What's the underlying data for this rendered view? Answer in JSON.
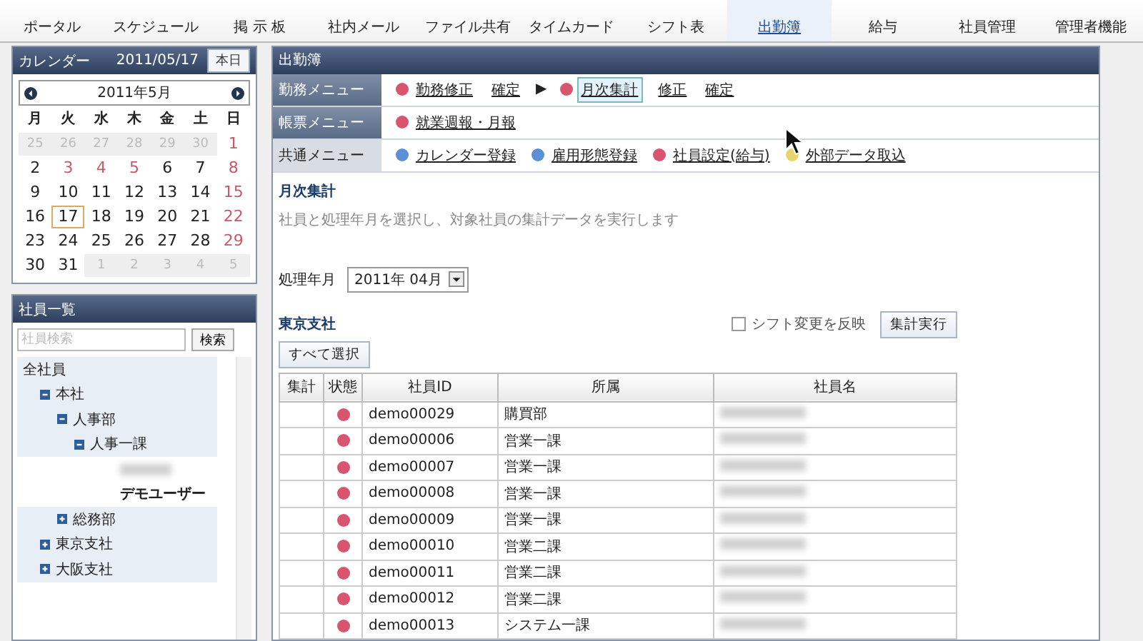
{
  "nav": [
    {
      "label": "ポータル",
      "selected": false
    },
    {
      "label": "スケジュール",
      "selected": false
    },
    {
      "label": "掲 示 板",
      "selected": false
    },
    {
      "label": "社内メール",
      "selected": false
    },
    {
      "label": "ファイル共有",
      "selected": false
    },
    {
      "label": "タイムカード",
      "selected": false
    },
    {
      "label": "シフト表",
      "selected": false
    },
    {
      "label": "出勤簿",
      "selected": true
    },
    {
      "label": "給与",
      "selected": false
    },
    {
      "label": "社員管理",
      "selected": false
    },
    {
      "label": "管理者機能",
      "selected": false
    }
  ],
  "calendar": {
    "title": "カレンダー",
    "date": "2011/05/17",
    "today_button": "本日",
    "month": "2011年5月",
    "weekdays": [
      "月",
      "火",
      "水",
      "木",
      "金",
      "土",
      "日"
    ],
    "weeks": [
      [
        {
          "label": "25",
          "muted": true,
          "holiday": false,
          "selected": false
        },
        {
          "label": "26",
          "muted": true,
          "holiday": false,
          "selected": false
        },
        {
          "label": "27",
          "muted": true,
          "holiday": false,
          "selected": false
        },
        {
          "label": "28",
          "muted": true,
          "holiday": false,
          "selected": false
        },
        {
          "label": "29",
          "muted": true,
          "holiday": false,
          "selected": false
        },
        {
          "label": "30",
          "muted": true,
          "holiday": false,
          "selected": false
        },
        {
          "label": "1",
          "muted": false,
          "holiday": true,
          "selected": false
        }
      ],
      [
        {
          "label": "2",
          "muted": false,
          "holiday": false,
          "selected": false
        },
        {
          "label": "3",
          "muted": false,
          "holiday": true,
          "selected": false
        },
        {
          "label": "4",
          "muted": false,
          "holiday": true,
          "selected": false
        },
        {
          "label": "5",
          "muted": false,
          "holiday": true,
          "selected": false
        },
        {
          "label": "6",
          "muted": false,
          "holiday": false,
          "selected": false
        },
        {
          "label": "7",
          "muted": false,
          "holiday": false,
          "selected": false
        },
        {
          "label": "8",
          "muted": false,
          "holiday": true,
          "selected": false
        }
      ],
      [
        {
          "label": "9",
          "muted": false,
          "holiday": false,
          "selected": false
        },
        {
          "label": "10",
          "muted": false,
          "holiday": false,
          "selected": false
        },
        {
          "label": "11",
          "muted": false,
          "holiday": false,
          "selected": false
        },
        {
          "label": "12",
          "muted": false,
          "holiday": false,
          "selected": false
        },
        {
          "label": "13",
          "muted": false,
          "holiday": false,
          "selected": false
        },
        {
          "label": "14",
          "muted": false,
          "holiday": false,
          "selected": false
        },
        {
          "label": "15",
          "muted": false,
          "holiday": true,
          "selected": false
        }
      ],
      [
        {
          "label": "16",
          "muted": false,
          "holiday": false,
          "selected": false
        },
        {
          "label": "17",
          "muted": false,
          "holiday": false,
          "selected": true
        },
        {
          "label": "18",
          "muted": false,
          "holiday": false,
          "selected": false
        },
        {
          "label": "19",
          "muted": false,
          "holiday": false,
          "selected": false
        },
        {
          "label": "20",
          "muted": false,
          "holiday": false,
          "selected": false
        },
        {
          "label": "21",
          "muted": false,
          "holiday": false,
          "selected": false
        },
        {
          "label": "22",
          "muted": false,
          "holiday": true,
          "selected": false
        }
      ],
      [
        {
          "label": "23",
          "muted": false,
          "holiday": false,
          "selected": false
        },
        {
          "label": "24",
          "muted": false,
          "holiday": false,
          "selected": false
        },
        {
          "label": "25",
          "muted": false,
          "holiday": false,
          "selected": false
        },
        {
          "label": "26",
          "muted": false,
          "holiday": false,
          "selected": false
        },
        {
          "label": "27",
          "muted": false,
          "holiday": false,
          "selected": false
        },
        {
          "label": "28",
          "muted": false,
          "holiday": false,
          "selected": false
        },
        {
          "label": "29",
          "muted": false,
          "holiday": true,
          "selected": false
        }
      ],
      [
        {
          "label": "30",
          "muted": false,
          "holiday": false,
          "selected": false
        },
        {
          "label": "31",
          "muted": false,
          "holiday": false,
          "selected": false
        },
        {
          "label": "1",
          "muted": true,
          "holiday": false,
          "selected": false
        },
        {
          "label": "2",
          "muted": true,
          "holiday": false,
          "selected": false
        },
        {
          "label": "3",
          "muted": true,
          "holiday": false,
          "selected": false
        },
        {
          "label": "4",
          "muted": true,
          "holiday": false,
          "selected": false
        },
        {
          "label": "5",
          "muted": true,
          "holiday": false,
          "selected": false
        }
      ]
    ]
  },
  "employees": {
    "title": "社員一覧",
    "search": {
      "placeholder": "社員検索"
    },
    "search_button": "検索",
    "tree": [
      {
        "label": "全社員",
        "kind": "group",
        "children": [
          {
            "label": "本社",
            "kind": "group",
            "expanded": true,
            "children": [
              {
                "label": "人事部",
                "kind": "group",
                "expanded": true,
                "children": [
                  {
                    "label": "人事一課",
                    "kind": "group",
                    "expanded": true,
                    "children": [
                      {
                        "kind": "blurred"
                      },
                      {
                        "label": "デモユーザー",
                        "kind": "person"
                      }
                    ]
                  }
                ]
              },
              {
                "label": "総務部",
                "kind": "group",
                "expanded": false
              }
            ]
          },
          {
            "label": "東京支社",
            "kind": "group",
            "expanded": false
          },
          {
            "label": "大阪支社",
            "kind": "group",
            "expanded": false
          }
        ]
      }
    ]
  },
  "main": {
    "title": "出勤簿",
    "menus": [
      {
        "label": "勤務メニュー",
        "highlighted": false,
        "items": [
          {
            "kind": "link",
            "label": "勤務修正",
            "color": "#d9546e",
            "selected": false
          },
          {
            "kind": "link",
            "label": "確定",
            "selected": false
          },
          {
            "kind": "arrow",
            "label": "▶"
          },
          {
            "kind": "link",
            "label": "月次集計",
            "color": "#d9546e",
            "selected": true
          },
          {
            "kind": "link",
            "label": "修正",
            "selected": false
          },
          {
            "kind": "link",
            "label": "確定",
            "selected": false
          }
        ]
      },
      {
        "label": "帳票メニュー",
        "highlighted": false,
        "items": [
          {
            "kind": "link",
            "label": "就業週報・月報",
            "color": "#d9546e",
            "selected": false
          }
        ]
      },
      {
        "label": "共通メニュー",
        "highlighted": true,
        "items": [
          {
            "kind": "link",
            "label": "カレンダー登録",
            "color": "#5b8fd6",
            "selected": false
          },
          {
            "kind": "link",
            "label": "雇用形態登録",
            "color": "#5b8fd6",
            "selected": false
          },
          {
            "kind": "link",
            "label": "社員設定(給与)",
            "color": "#d9546e",
            "selected": false
          },
          {
            "kind": "link",
            "label": "外部データ取込",
            "color": "#e8d46a",
            "selected": false
          }
        ]
      }
    ],
    "section_title": "月次集計",
    "description": "社員と処理年月を選択し、対象社員の集計データを実行します",
    "period_label": "処理年月",
    "period_value": "2011年 04月",
    "branch": "東京支社",
    "shift_checkbox": {
      "label": "シフト変更を反映",
      "checked": false
    },
    "run_button": "集計実行",
    "select_all_button": "すべて選択",
    "table": {
      "columns": [
        "集計",
        "状態",
        "社員ID",
        "所属",
        "社員名"
      ],
      "rows": [
        {
          "color": "#d9546e",
          "id": "demo00029",
          "dept": "購買部"
        },
        {
          "color": "#d9546e",
          "id": "demo00006",
          "dept": "営業一課"
        },
        {
          "color": "#d9546e",
          "id": "demo00007",
          "dept": "営業一課"
        },
        {
          "color": "#d9546e",
          "id": "demo00008",
          "dept": "営業一課"
        },
        {
          "color": "#d9546e",
          "id": "demo00009",
          "dept": "営業一課"
        },
        {
          "color": "#d9546e",
          "id": "demo00010",
          "dept": "営業二課"
        },
        {
          "color": "#d9546e",
          "id": "demo00011",
          "dept": "営業二課"
        },
        {
          "color": "#d9546e",
          "id": "demo00012",
          "dept": "営業二課"
        },
        {
          "color": "#d9546e",
          "id": "demo00013",
          "dept": "システム一課"
        }
      ]
    }
  }
}
